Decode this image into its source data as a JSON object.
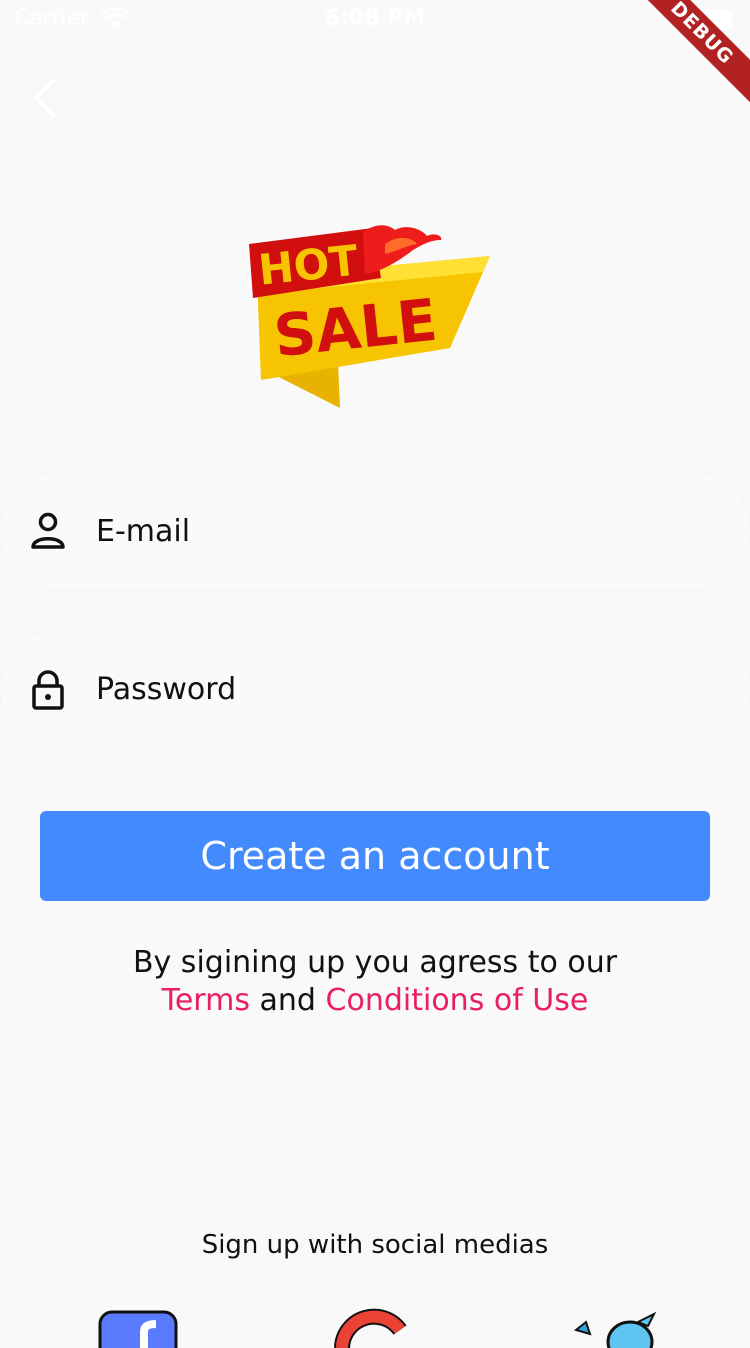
{
  "status_bar": {
    "carrier": "Carrier",
    "time": "6:08 PM"
  },
  "debug_banner": "DEBUG",
  "logo": {
    "line1": "HOT",
    "line2": "SALE"
  },
  "form": {
    "email_placeholder": "E-mail",
    "password_placeholder": "Password",
    "create_button": "Create an account"
  },
  "terms": {
    "line1": "By sigining up you agress to our",
    "terms_link": "Terms",
    "and": "and",
    "conditions_link": "Conditions of Use"
  },
  "social": {
    "caption": "Sign up with social medias",
    "icons": [
      "facebook-icon",
      "google-icon",
      "twitter-icon"
    ]
  },
  "colors": {
    "background": "#f9f9f9",
    "primary_button": "#448aff",
    "link": "#e91e63",
    "debug_banner": "#b22222"
  }
}
